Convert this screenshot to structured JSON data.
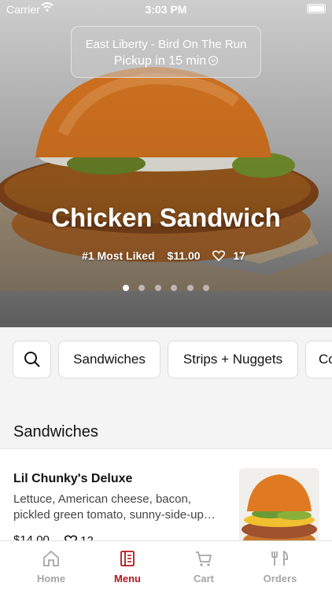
{
  "status_bar": {
    "carrier": "Carrier",
    "time": "3:03 PM"
  },
  "location": {
    "name": "East Liberty - Bird On The Run",
    "pickup": "Pickup in 15 min"
  },
  "hero": {
    "title": "Chicken Sandwich",
    "tagline": "#1 Most Liked",
    "price": "$11.00",
    "likes": "17",
    "slide_count": 6,
    "active_slide": 1
  },
  "categories": [
    "Sandwiches",
    "Strips + Nuggets",
    "Co"
  ],
  "section": {
    "title": "Sandwiches"
  },
  "menu_item": {
    "name": "Lil Chunky's Deluxe",
    "description": "Lettuce, American cheese, bacon, pickled green tomato, sunny-side-up…",
    "price": "$14.00",
    "likes": "12"
  },
  "tabs": [
    {
      "label": "Home",
      "icon": "home-icon"
    },
    {
      "label": "Menu",
      "icon": "menu-icon"
    },
    {
      "label": "Cart",
      "icon": "cart-icon"
    },
    {
      "label": "Orders",
      "icon": "orders-icon"
    }
  ],
  "colors": {
    "accent": "#b3161b",
    "inactive": "#a6a6a6"
  }
}
